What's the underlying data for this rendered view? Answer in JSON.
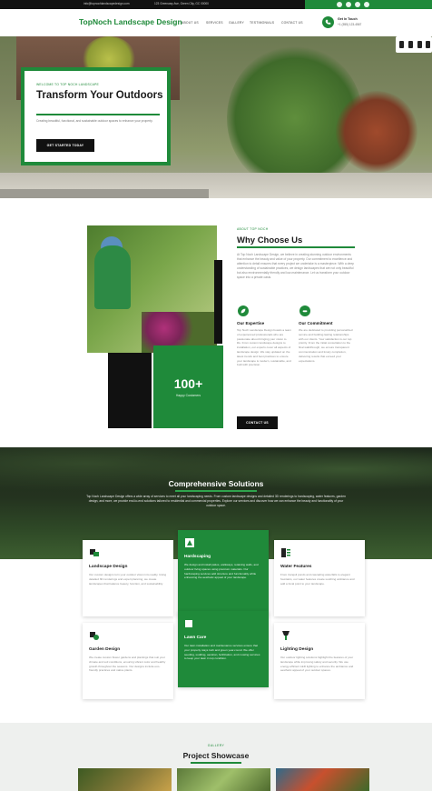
{
  "topbar": {
    "email": "info@topnochlandscapedesign.com",
    "address": "123 Greenway Ave, Green City, GC 00000",
    "social_icons": [
      "facebook-icon",
      "twitter-icon",
      "instagram-icon",
      "linkedin-icon"
    ]
  },
  "header": {
    "logo": "TopNoch Landscape Design",
    "nav": [
      "ABOUT US",
      "SERVICES",
      "GALLERY",
      "TESTIMONIALS",
      "CONTACT US"
    ],
    "call_label": "Get In Touch",
    "call_number": "+1 (555) 123-4567"
  },
  "hero": {
    "kicker": "WELCOME TO TOP NOCH LANDSCAPE",
    "title": "Transform Your Outdoors",
    "description": "Creating beautiful, functional, and sustainable outdoor spaces to enhance your property.",
    "button": "GET STARTED TODAY"
  },
  "about": {
    "kicker": "ABOUT TOP NOCH",
    "title": "Why Choose Us",
    "description": "At Top Noch Landscape Design, we believe in creating stunning outdoor environments that enhance the beauty and value of your property. Our commitment to excellence and attention to detail ensures that every project we undertake is a masterpiece. With a deep understanding of sustainable practices, we design landscapes that are not only beautiful but also environmentally friendly and low-maintenance. Let us transform your outdoor space into a private oasis.",
    "stat_number": "100+",
    "stat_label": "Happy Customers",
    "expertise_title": "Our Expertise",
    "expertise_text": "Top Noch Landscape Design boasts a team of experienced professionals who are passionate about bringing your vision to life. From custom landscape designs to installation, our experts cover all aspects of landscape design. We stay updated on the latest trends and best practices to ensure your landscape is modern, sustainable, and built with precision.",
    "commitment_title": "Our Commitment",
    "commitment_text": "We are dedicated to providing personalized service and building lasting relationships with our clients. Your satisfaction is our top priority. From the initial consultation to the final walkthrough, we ensure transparent communication and timely completion, delivering results that exceed your expectations.",
    "button": "CONTACT US"
  },
  "services": {
    "title": "Comprehensive Solutions",
    "description": "Top Noch Landscape Design offers a wide array of services to meet all your landscaping needs. From custom landscape designs and detailed 3D renderings to hardscaping, water features, garden design, and more, we provide end-to-end solutions tailored to residential and commercial properties. Explore our services and discover how we can enhance the beauty and functionality of your outdoor space.",
    "cards": [
      {
        "title": "Landscape Design",
        "icon": "blueprint-icon",
        "text": "Our custom designs turn your outdoor vision into reality. Using detailed 3D renderings and expert planning, we create landscapes that balance beauty, function, and sustainability."
      },
      {
        "title": "Hardscaping",
        "icon": "paver-icon",
        "text": "We design and install patios, walkways, retaining walls, and outdoor living spaces using premium materials. Our hardscaping services add structure and functionality while enhancing the aesthetic appeal of your landscape."
      },
      {
        "title": "Water Features",
        "icon": "fountain-icon",
        "text": "From tranquil ponds and cascading waterfalls to elegant fountains, our water features create soothing ambiance and add a focal point to your landscape."
      },
      {
        "title": "Garden Design",
        "icon": "garden-icon",
        "text": "We create custom flower gardens and plantings that suit your climate and soil conditions, ensuring vibrant color and healthy growth throughout the seasons. Our designs include eco-friendly practices and native plants."
      },
      {
        "title": "Lawn Care",
        "icon": "mower-icon",
        "text": "Our lawn installation and maintenance services ensure that your property stays lush and green year-round. We offer seeding, sodding, aeration, fertilization, and mowing services to keep your lawn in top condition."
      },
      {
        "title": "Lighting Design",
        "icon": "lamp-icon",
        "text": "Our outdoor lighting solutions highlight the features of your landscape while improving safety and security. We use energy-efficient LED lighting to enhance the ambiance and aesthetic appeal of your outdoor spaces."
      }
    ]
  },
  "gallery": {
    "kicker": "GALLERY",
    "title": "Project Showcase"
  },
  "colors": {
    "brand_green": "#1f8a3a",
    "dark": "#111111"
  }
}
